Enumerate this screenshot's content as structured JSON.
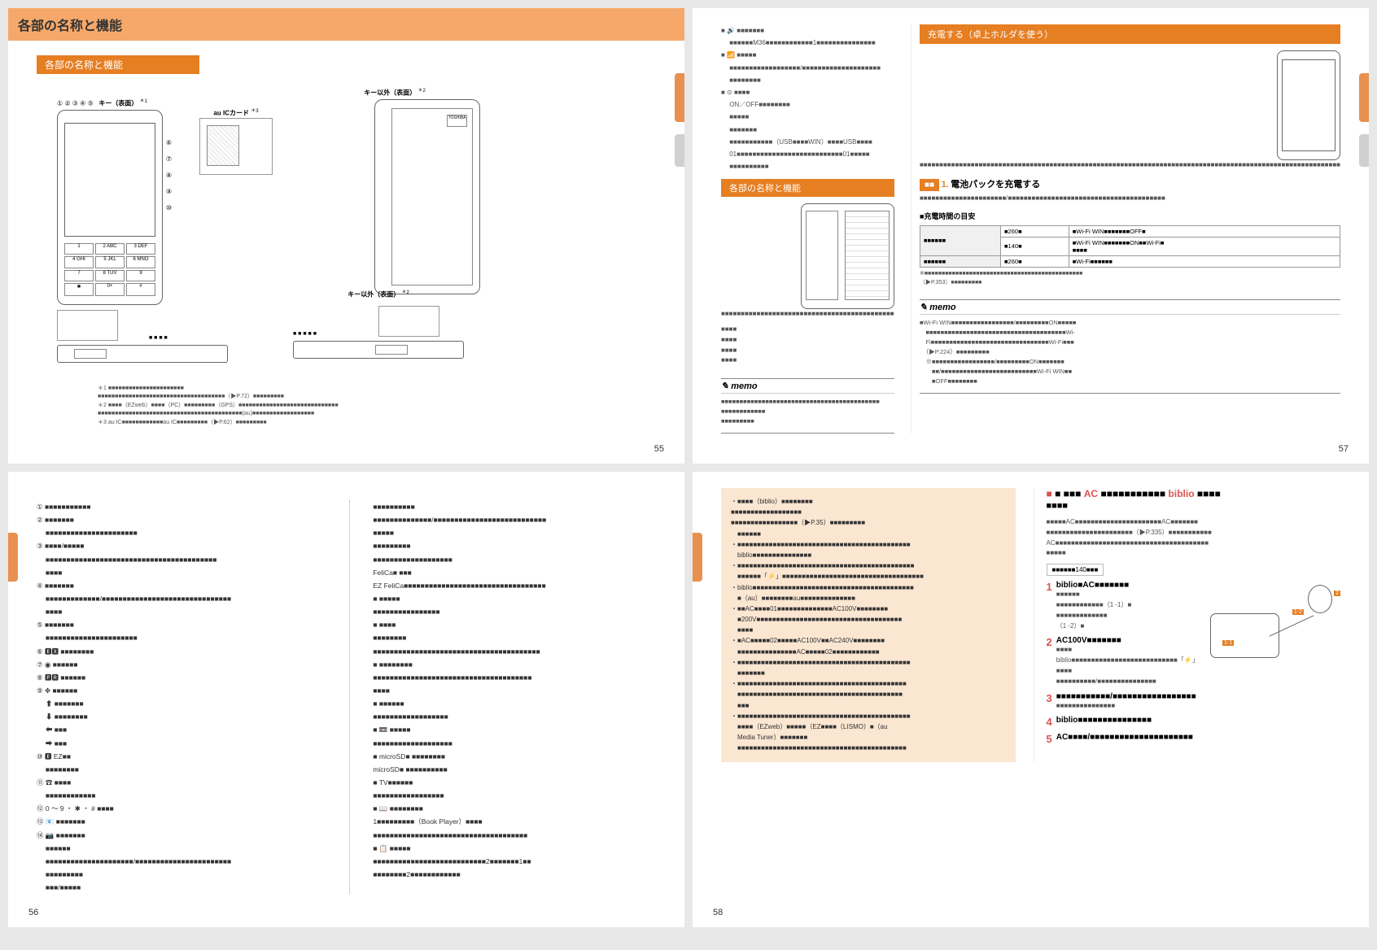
{
  "page_numbers": {
    "p55": "55",
    "p56": "56",
    "p57": "57",
    "p58": "58"
  },
  "p55": {
    "title": "各部の名称と機能",
    "subtitle": "各部の名称と機能",
    "front_label": "キー（表面）",
    "front_star1": "＊1",
    "back_label": "キー以外（表面）",
    "back_star2": "＊2",
    "au_ic_label": "au ICカード",
    "au_ic_star3": "＊3",
    "bottom2_label": "キー以外（表面）",
    "notes": {
      "n1": "＊1 ■■■■■■■■■■■■■■■■■■■■■■",
      "n1b": "■■■■■■■■■■■■■■■■■■■■■■■■■■■■■■■■■■■■■（▶P.72）■■■■■■■■■",
      "n2": "＊2 ■■■■（EZweb）■■■■（PC）■■■■■■■■■（GPS）■■■■■■■■■■■■■■■■■■■■■■■■■■■■■",
      "n2b": "■■■■■■■■■■■■■■■■■■■■■■■■■■■■■■■■■■■■■■■■■■(au)■■■■■■■■■■■■■■■■■■",
      "n3": "＊3 au IC■■■■■■■■■■■■au IC■■■■■■■■■（▶P.62）■■■■■■■■■"
    }
  },
  "p56": {
    "left_items": [
      "① ■■■■■■■■■■■",
      "② ■■■■■■■",
      "　 ■■■■■■■■■■■■■■■■■■■■■■",
      "③ ■■■■/■■■■■",
      "　 ■■■■■■■■■■■■■■■■■■■■■■■■■■■■■■■■■■■■■■■■■",
      "　 ■■■■",
      "④ ■■■■■■■",
      "　 ■■■■■■■■■■■■■/■■■■■■■■■■■■■■■■■■■■■■■■■■■■■■■",
      "　 ■■■■",
      "⑤ ■■■■■■■",
      "　 ■■■■■■■■■■■■■■■■■■■■■■",
      "⑥ 🅴🆇 ■■■■■■■■",
      "⑦ ◉ ■■■■■■",
      "⑧ 🅿🆁 ■■■■■■",
      "⑨ ✥ ■■■■■■",
      "　 ⬆ ■■■■■■■",
      "　 ⬇ ■■■■■■■■",
      "　 ⬅ ■■■",
      "　 ➡ ■■■",
      "⑩ 🅴 EZ■■",
      "　 ■■■■■■■■",
      "⑪ ☎ ■■■■",
      "　 ■■■■■■■■■■■■",
      "⑫ 0 ～ 9 ・ ✱ ・ # ■■■■",
      "⑬ 📧 ■■■■■■■",
      "⑭ 📷 ■■■■■■■",
      "　 ■■■■■■",
      "　 ■■■■■■■■■■■■■■■■■■■■■/■■■■■■■■■■■■■■■■■■■■■■■",
      "　 ■■■■■■■■■",
      "　 ■■■/■■■■■"
    ],
    "right_items": [
      "　 ■■■■■■■■■■",
      "　 ■■■■■■■■■■■■■■/■■■■■■■■■■■■■■■■■■■■■■■■■■■",
      "　 ■■■■■",
      "　 ■■■■■■■■■",
      "　 ■■■■■■■■■■■■■■■■■■■",
      "　 FeliCa■ ■■■",
      "　 EZ FeliCa■■■■■■■■■■■■■■■■■■■■■■■■■■■■■■■■■■",
      "　 ■ ■■■■■",
      "　 ■■■■■■■■■■■■■■■■",
      "　 ■ ■■■■",
      "　 ■■■■■■■■",
      "　 ■■■■■■■■■■■■■■■■■■■■■■■■■■■■■■■■■■■■■■■■",
      "　 ■ ■■■■■■■■",
      "　 ■■■■■■■■■■■■■■■■■■■■■■■■■■■■■■■■■■■■■■",
      "　 ■■■■",
      "　 ■ ■■■■■■",
      "　 ■■■■■■■■■■■■■■■■■■",
      "　 ■ 📼 ■■■■■",
      "　 ■■■■■■■■■■■■■■■■■■■",
      "　 ■ microSD■ ■■■■■■■■",
      "　 microSD■ ■■■■■■■■■■",
      "　 ■ TV■■■■■■",
      "　 ■■■■■■■■■■■■■■■■■",
      "　 ■ 📖 ■■■■■■■■",
      "　 1■■■■■■■■■（Book Player）■■■■",
      "　 ■■■■■■■■■■■■■■■■■■■■■■■■■■■■■■■■■■■■■",
      "　 ■ 📋 ■■■■■",
      "　 ■■■■■■■■■■■■■■■■■■■■■■■■■■■2■■■■■■■1■■",
      "　 ■■■■■■■■2■■■■■■■■■■■■"
    ]
  },
  "p57": {
    "left_icon_items": [
      "■ 🔊 ■■■■■■■",
      "　 ■■■■■■M36■■■■■■■■■■■■1■■■■■■■■■■■■■■■",
      "■ 📶 ■■■■■",
      "　 ■■■■■■■■■■■■■■■■■■/■■■■■■■■■■■■■■■■■■■■",
      "　 ■■■■■■■■",
      "■ ⊙ ■■■■",
      "　 ON／OFF■■■■■■■■",
      "　 ■■■■■",
      "　 ■■■■■■■",
      "　 ■■■■■■■■■■■（USB■■■■WIN）■■■■USB■■■■",
      "　 01■■■■■■■■■■■■■■■■■■■■■■■■■■■01■■■■■",
      "　 ■■■■■■■■■■"
    ],
    "open_close_title": "各部の名称と機能",
    "open_close_text": "■■■■■■■■■■■■■■■■■■■■■■■■■■■■■■■■■■■■■■■■■■■■",
    "memo_left": "■■■■■■■■■■■■■■■■■■■■■■■■■■■■■■■■■■■■■■■■■■■\n■■■■■■■■■■■■\n■■■■■■■■■",
    "right_title": "充電する（卓上ホルダを使う）",
    "right_intro": "■■■■■■■■■■■■■■■■■■■■■■■■■■■■■■■■■■■■■■■■■■■■■■■■■■■■■■■■■■■■■■■■■■■■■■■■■■■■■■■■■■■■■■■■■■■■■■■■■■■■■■■■■■■",
    "phone_label_r1": "■■■\n■■■",
    "phone_label_r2": "■■■■\n■■■",
    "step1": "1.",
    "step1_txt": "電池パックを充電する",
    "step1_sub": "■■■■■■■■■■■■■■■■■■■■■■/■■■■■■■■■■■■■■■■■■■■■■■■■■■■■■■■■■■■■■■■",
    "tbl_header": "■充電時間の目安",
    "tbl": {
      "r1c1": "■■■■■■",
      "r1c2": "■260■",
      "r1c3": "■Wi-Fi WIN■■■■■■■OFF■",
      "r2c1": "■■■■■■",
      "r2c2": "■140■",
      "r2c3": "■Wi-Fi WIN■■■■■■■ON■■Wi-Fi■\n■■■■",
      "r3c1": "",
      "r3c2": "■260■",
      "r3c3": "■Wi-Fi■■■■■■"
    },
    "tbl_note": "※■■■■■■■■■■■■■■■■■■■■■■■■■■■■■■■■■■■■■■■■■■■■■■\n（▶P.353）■■■■■■■■■",
    "memo_right": "■Wi-Fi WIN■■■■■■■■■■■■■■■■■/■■■■■■■■■ON■■■■■\n　■■■■■■■■■■■■■■■■■■■■■■■■■■■■■■■■■■■■■■Wi-\n　Fi■■■■■■■■■■■■■■■■■■■■■■■■■■■■■■■■Wi-Fi■■■\n　（▶P.224）■■■■■■■■■\n　※■■■■■■■■■■■■■■■■■/■■■■■■■■■ON■■■■■■■\n　　■■/■■■■■■■■■■■■■■■■■■■■■■■■■■Wi-Fi WIN■■\n　　■OFF■■■■■■■■"
  },
  "p58": {
    "warn": [
      "・■■■■（biblio）■■■■■■■■",
      "■■■■■■■■■■■■■■■■■■",
      "■■■■■■■■■■■■■■■■■（▶P.35）■■■■■■■■■",
      "　■■■■■■",
      "・■■■■■■■■■■■■■■■■■■■■■■■■■■■■■■■■■■■■■■■■■■■■",
      "　biblio■■■■■■■■■■■■■■■",
      "・■■■■■■■■■■■■■■■■■■■■■■■■■■■■■■■■■■■■■■■■■■■■■",
      "　■■■■■■「⚡」■■■■■■■■■■■■■■■■■■■■■■■■■■■■■■■■■■■■",
      "・biblio■■■■■■■■■■■■■■■■■■■■■■■■■■■■■■■■■■■■■■■■■",
      "　■（au）■■■■■■■■au■■■■■■■■■■■■■■",
      "・■■AC■■■■01■■■■■■■■■■■■■■AC100V■■■■■■■■",
      "　■200V■■■■■■■■■■■■■■■■■■■■■■■■■■■■■■■■■■■■■",
      "　■■■■",
      "・■AC■■■■■02■■■■■AC100V■■AC240V■■■■■■■■",
      "　■■■■■■■■■■■■■■■AC■■■■■02■■■■■■■■■■■■",
      "・■■■■■■■■■■■■■■■■■■■■■■■■■■■■■■■■■■■■■■■■■■■■",
      "　■■■■■■■",
      "・■■■■■■■■■■■■■■■■■■■■■■■■■■■■■■■■■■■■■■■■■■■",
      "　■■■■■■■■■■■■■■■■■■■■■■■■■■■■■■■■■■■■■■■■■■",
      "　■■■",
      "・■■■■■■■■■■■■■■■■■■■■■■■■■■■■■■■■■■■■■■■■■■■■",
      "　■■■■（EZweb）■■■■■（EZ■■■■（LISMO）■（au",
      "　Media Tuner）■■■■■■■",
      "　■■■■■■■■■■■■■■■■■■■■■■■■■■■■■■■■■■■■■■■■■■■"
    ],
    "right_title_pre": "■ ■■■",
    "right_title_ac": "AC",
    "right_title_mid": "■■■■■■■■■■■",
    "right_title_biblio": "biblio",
    "right_title_end": "■■■■",
    "right_intro": "■■■■■AC■■■■■■■■■■■■■■■■■■■■■■AC■■■■■■■\n■■■■■■■■■■■■■■■■■■■■■■（▶P.335）■■■■■■■■■■■\nAC■■■■■■■■■■■■■■■■■■■■■■■■■■■■■■■■■■■■■■■\n■■■■■",
    "charge_time": "■■■■■■140■■■",
    "steps": [
      {
        "n": "1",
        "title": "biblio■AC■■■■■■■",
        "sub": "■■■■■■\n■■■■■■■■■■■■（1 -1）■\n■■■■■■■■■■■■■\n（1 -2）■"
      },
      {
        "n": "2",
        "title": "AC100V■■■■■■■",
        "sub": "■■■■\nbiblio■■■■■■■■■■■■■■■■■■■■■■■■■■■「⚡」■■■■\n■■■■■■■■■■/■■■■■■■■■■■■■■■"
      },
      {
        "n": "3",
        "title": "■■■■■■■■■■■/■■■■■■■■■■■■■■■■■",
        "sub": "■■■■■■■■■■■■■■■"
      },
      {
        "n": "4",
        "title": "biblio■■■■■■■■■■■■■■■",
        "sub": ""
      },
      {
        "n": "5",
        "title": "AC■■■■/■■■■■■■■■■■■■■■■■■■■■",
        "sub": ""
      }
    ],
    "diag_labels": {
      "a": "1-1",
      "b": "1-2",
      "c": "2"
    }
  }
}
